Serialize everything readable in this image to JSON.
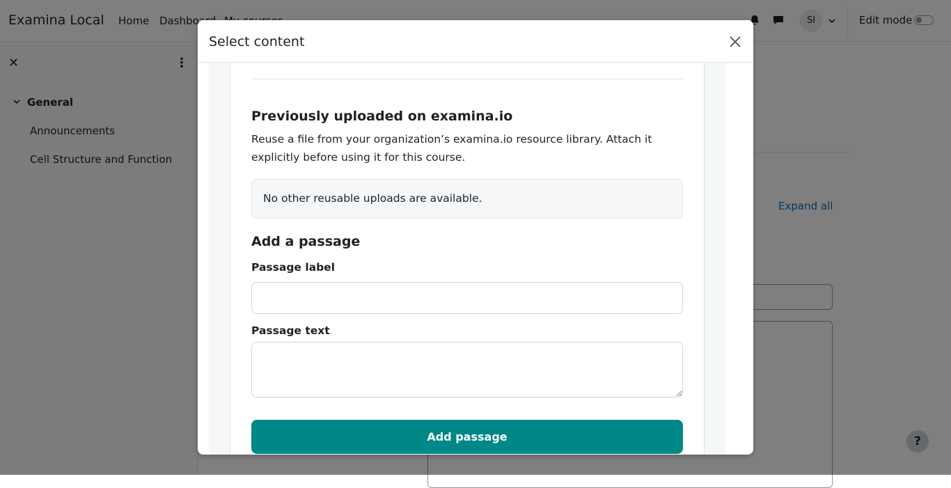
{
  "navbar": {
    "brand": "Examina Local",
    "links": [
      "Home",
      "Dashboard",
      "My courses"
    ],
    "avatar_initials": "SI",
    "edit_mode_label": "Edit mode",
    "icons": [
      "bell-icon",
      "chat-icon",
      "chevron-down-icon"
    ]
  },
  "drawer": {
    "section": "General",
    "items": [
      "Announcements",
      "Cell Structure and Function"
    ]
  },
  "background": {
    "expand_all": "Expand all",
    "help": "?"
  },
  "modal": {
    "title": "Select content",
    "previously_uploaded": {
      "heading": "Previously uploaded on examina.io",
      "description": "Reuse a file from your organization’s examina.io resource library. Attach it explicitly before using it for this course.",
      "empty_notice": "No other reusable uploads are available."
    },
    "add_passage": {
      "heading": "Add a passage",
      "label_field": {
        "label": "Passage label",
        "value": "",
        "placeholder": ""
      },
      "text_field": {
        "label": "Passage text",
        "value": "",
        "placeholder": ""
      },
      "button": "Add passage"
    }
  },
  "colors": {
    "accent": "#008787",
    "link": "#0f6cbf",
    "backdrop": "rgba(0,0,0,0.5)"
  }
}
